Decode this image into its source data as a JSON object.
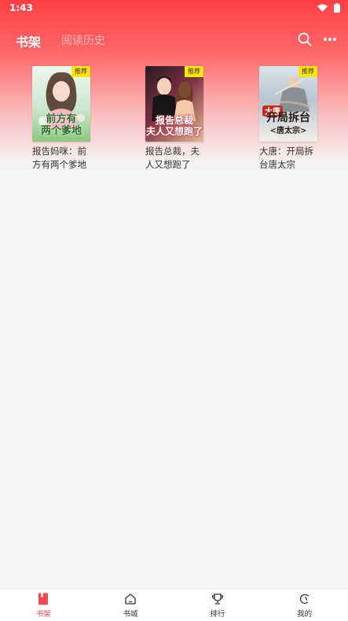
{
  "status_bar": {
    "time": "1:43"
  },
  "header": {
    "tabs": [
      {
        "label": "书架",
        "active": true
      },
      {
        "label": "阅读历史",
        "active": false
      }
    ]
  },
  "books": [
    {
      "title": "报告妈咪：前方有两个爹地",
      "badge": "推荐",
      "cover_text": "前方有两个爹地",
      "cover_colors": [
        "#e8f4ea",
        "#bfe0c4",
        "#7fbf74"
      ]
    },
    {
      "title": "报告总裁，夫人又想跑了",
      "badge": "推荐",
      "cover_text": "报告总裁夫人又想跑了",
      "cover_colors": [
        "#3a1f2a",
        "#a3435a",
        "#f2c9a5"
      ]
    },
    {
      "title": "大唐：开局拆台唐太宗",
      "badge": "推荐",
      "cover_text": "开局拆台唐太宗",
      "cover_colors": [
        "#d8e2ea",
        "#a7b7c4",
        "#f4f1ee"
      ]
    }
  ],
  "bottom_nav": [
    {
      "label": "书架",
      "icon": "book-icon",
      "active": true
    },
    {
      "label": "书城",
      "icon": "home-icon",
      "active": false
    },
    {
      "label": "排行",
      "icon": "trophy-icon",
      "active": false
    },
    {
      "label": "我的",
      "icon": "profile-icon",
      "active": false
    }
  ],
  "colors": {
    "accent": "#f04a4c",
    "badge": "#ffe500"
  }
}
